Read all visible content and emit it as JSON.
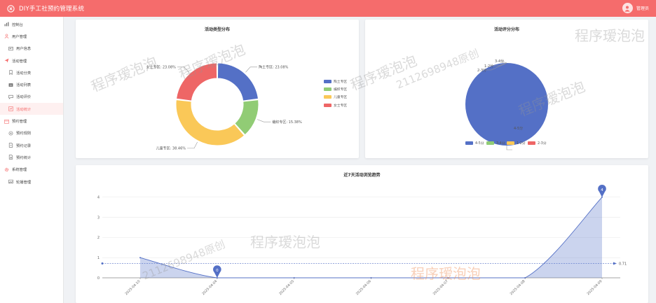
{
  "header": {
    "title": "DIY手工社预约管理系统",
    "user_name": "管理员"
  },
  "sidebar": [
    {
      "label": "控制台",
      "icon": "bar-chart-icon",
      "level": "group",
      "active": false
    },
    {
      "label": "用户管理",
      "icon": "user-icon",
      "level": "group",
      "active": false
    },
    {
      "label": "用户信息",
      "icon": "user-card-icon",
      "level": "sub",
      "active": false
    },
    {
      "label": "活动管理",
      "icon": "paper-plane-icon",
      "level": "group",
      "active": false
    },
    {
      "label": "活动分类",
      "icon": "bookmark-icon",
      "level": "sub",
      "active": false
    },
    {
      "label": "活动列表",
      "icon": "list-icon",
      "level": "sub",
      "active": false
    },
    {
      "label": "活动评价",
      "icon": "comment-icon",
      "level": "sub",
      "active": false
    },
    {
      "label": "活动统计",
      "icon": "stats-icon",
      "level": "sub",
      "active": true
    },
    {
      "label": "预约管理",
      "icon": "calendar-icon",
      "level": "group",
      "active": false
    },
    {
      "label": "预约规则",
      "icon": "settings-icon",
      "level": "sub",
      "active": false
    },
    {
      "label": "预约记录",
      "icon": "document-icon",
      "level": "sub",
      "active": false
    },
    {
      "label": "预约统计",
      "icon": "chart-doc-icon",
      "level": "sub",
      "active": false
    },
    {
      "label": "系统管理",
      "icon": "gear-icon",
      "level": "group",
      "active": false
    },
    {
      "label": "轮播管理",
      "icon": "picture-icon",
      "level": "sub",
      "active": false
    }
  ],
  "watermarks": {
    "cn": "程序瑷泡泡",
    "num": "2112698948原创"
  },
  "chart_data": [
    {
      "type": "pie",
      "variant": "donut",
      "title": "活动类型分布",
      "legend_position": "right",
      "slices": [
        {
          "name": "陶土专区",
          "value": 23.08,
          "label": "陶土专区: 23.08%",
          "color": "#5470c6"
        },
        {
          "name": "编织专区",
          "value": 15.38,
          "label": "编织专区: 15.38%",
          "color": "#91cc75"
        },
        {
          "name": "儿童专区",
          "value": 38.46,
          "label": "儿童专区: 38.46%",
          "color": "#fac858"
        },
        {
          "name": "女士专区",
          "value": 23.08,
          "label": "女士专区: 23.08%",
          "color": "#ee6666"
        }
      ]
    },
    {
      "type": "pie",
      "title": "活动评分分布",
      "legend_position": "bottom",
      "slices": [
        {
          "name": "4-5分",
          "value": 100,
          "label": "4-5分",
          "color": "#5470c6"
        },
        {
          "name": "3-4分",
          "value": 0,
          "label": "3-4分",
          "color": "#91cc75"
        },
        {
          "name": "1-2分",
          "value": 0,
          "label": "1-2分",
          "color": "#fac858"
        },
        {
          "name": "2-3分",
          "value": 0,
          "label": "2-3分",
          "color": "#ee6666"
        }
      ]
    },
    {
      "type": "area",
      "title": "近7天活动浏览趋势",
      "x": [
        "2025-04-10",
        "2025-04-04",
        "2025-04-05",
        "2025-04-06",
        "2025-04-07",
        "2025-04-08",
        "2025-04-09"
      ],
      "series": [
        {
          "values": [
            1,
            0,
            0,
            0,
            0,
            0,
            4
          ],
          "color": "#5470c6"
        }
      ],
      "yticks": [
        0,
        1,
        2,
        3,
        4
      ],
      "ylim": [
        0,
        4.2
      ],
      "markpoints": [
        {
          "label": "0",
          "index": 1,
          "value": 0
        },
        {
          "label": "4",
          "index": 6,
          "value": 4
        }
      ],
      "average_line": {
        "value": 0.71,
        "label": "0.71"
      },
      "grid": true
    }
  ]
}
